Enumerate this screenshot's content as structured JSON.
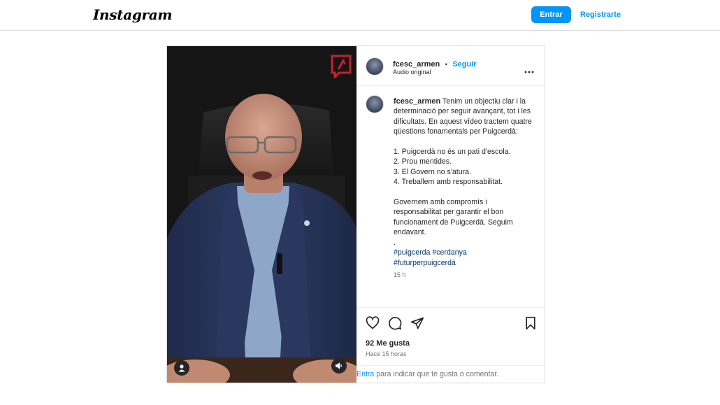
{
  "header": {
    "logo": "Instagram",
    "login_label": "Entrar",
    "signup_label": "Registrarte"
  },
  "post": {
    "username": "fcesc_armen",
    "separator": "•",
    "follow_label": "Seguir",
    "audio": "Audio original",
    "more_icon": "more-horizontal-icon",
    "caption": {
      "username": "fcesc_armen",
      "intro": "Tenim un objectiu clar i la determinació per seguir avançant, tot i les dificultats. En aquest vídeo tractem quatre qüestions fonamentals per Puigcerdà:",
      "points": [
        "1. Puigcerdà no és un pati d'escola.",
        "2. Prou mentides.",
        "3. El Govern no s'atura.",
        "4. Treballem amb responsabilitat."
      ],
      "closing": "Governem amb compromís i responsabilitat per garantir el bon funcionament de Puigcerdà. Seguim endavant.",
      "dot": ".",
      "hashtags_line1": "#puigcerda #cerdanya",
      "hashtags_line2": "#futurperpuigcerdà",
      "time": "15 h"
    },
    "likes": "92 Me gusta",
    "posted": "Hace 15 horas",
    "comment_login": "Entra",
    "comment_rest": " para indicar que te gusta o comentar."
  },
  "colors": {
    "accent": "#0095f6",
    "hashtag": "#00376b",
    "badge": "#c8202f"
  },
  "icons": [
    "like-icon",
    "comment-icon",
    "share-icon",
    "save-icon",
    "user-tag-icon",
    "volume-icon",
    "channel-badge-icon"
  ]
}
